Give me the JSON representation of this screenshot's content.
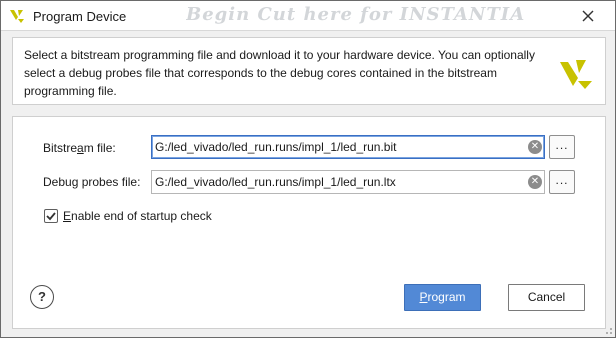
{
  "window": {
    "title": "Program Device",
    "background_text": "Begin Cut here for INSTANTIA"
  },
  "description": "Select a bitstream programming file and download it to your hardware device. You can optionally select a debug probes file that corresponds to the debug cores contained in the bitstream programming file.",
  "form": {
    "bitstream_label_pre": "Bitstre",
    "bitstream_label_accel": "a",
    "bitstream_label_post": "m file:",
    "bitstream_value": "G:/led_vivado/led_run.runs/impl_1/led_run.bit",
    "debug_label_pre": "Debu",
    "debug_label_accel": "g",
    "debug_label_post": " probes file:",
    "debug_value": "G:/led_vivado/led_run.runs/impl_1/led_run.ltx",
    "browse_label": "...",
    "startup_check_label_accel": "E",
    "startup_check_label_post": "nable end of startup check",
    "startup_check_checked": true
  },
  "footer": {
    "help_label": "?",
    "program_label_accel": "P",
    "program_label_post": "rogram",
    "cancel_label": "Cancel"
  },
  "colors": {
    "accent": "#5289d6",
    "logo_yellow": "#c8c200"
  },
  "icons": [
    "vivado-logo-icon",
    "close-icon",
    "clear-icon",
    "checkmark-icon",
    "help-icon",
    "resize-grip-icon"
  ]
}
